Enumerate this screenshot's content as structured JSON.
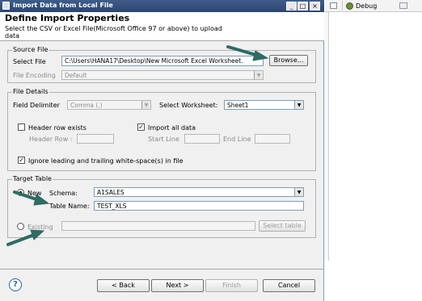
{
  "window": {
    "title": "Import Data from Local File",
    "title_icon": "import-icon",
    "controls": [
      "_",
      "□",
      "×"
    ]
  },
  "header": {
    "title": "Define Import Properties",
    "description": "Select the CSV or Excel File(Microsoft Office 97 or above) to upload data"
  },
  "source_file": {
    "group_title": "Source File",
    "select_file_label": "Select File",
    "select_file_value": "C:\\Users\\HANA17\\Desktop\\New Microsoft Excel Worksheet.",
    "browse_label": "Browse...",
    "encoding_label": "File Encoding",
    "encoding_value": "Default"
  },
  "file_details": {
    "group_title": "File Details",
    "field_delimiter_label": "Field Delimiter",
    "field_delimiter_value": "Comma (,)",
    "select_worksheet_label": "Select Worksheet:",
    "select_worksheet_value": "Sheet1",
    "header_row_exists_label": "Header row exists",
    "header_row_exists_checked": false,
    "header_row_label": "Header Row :",
    "import_all_label": "Import all data",
    "import_all_checked": true,
    "start_line_label": "Start Line",
    "end_line_label": "End Line",
    "ignore_whitespace_label": "Ignore leading and trailing white-space(s) in file",
    "ignore_whitespace_checked": true
  },
  "target_table": {
    "group_title": "Target Table",
    "new_label": "New",
    "new_selected": true,
    "schema_label": "Schema:",
    "schema_value": "A1SALES",
    "table_name_label": "Table Name:",
    "table_name_value": "TEST_XLS",
    "existing_label": "Existing",
    "existing_selected": false,
    "select_table_label": "Select table"
  },
  "footer": {
    "help_glyph": "?",
    "back_label": "< Back",
    "next_label": "Next >",
    "finish_label": "Finish",
    "cancel_label": "Cancel"
  },
  "right_pane": {
    "debug_label": "Debug",
    "debug_icon": "debug-icon"
  },
  "colors": {
    "title_bar": "#2f4c7c",
    "annotation_arrow": "#2e6b62",
    "group_border": "#b0b0b0"
  }
}
